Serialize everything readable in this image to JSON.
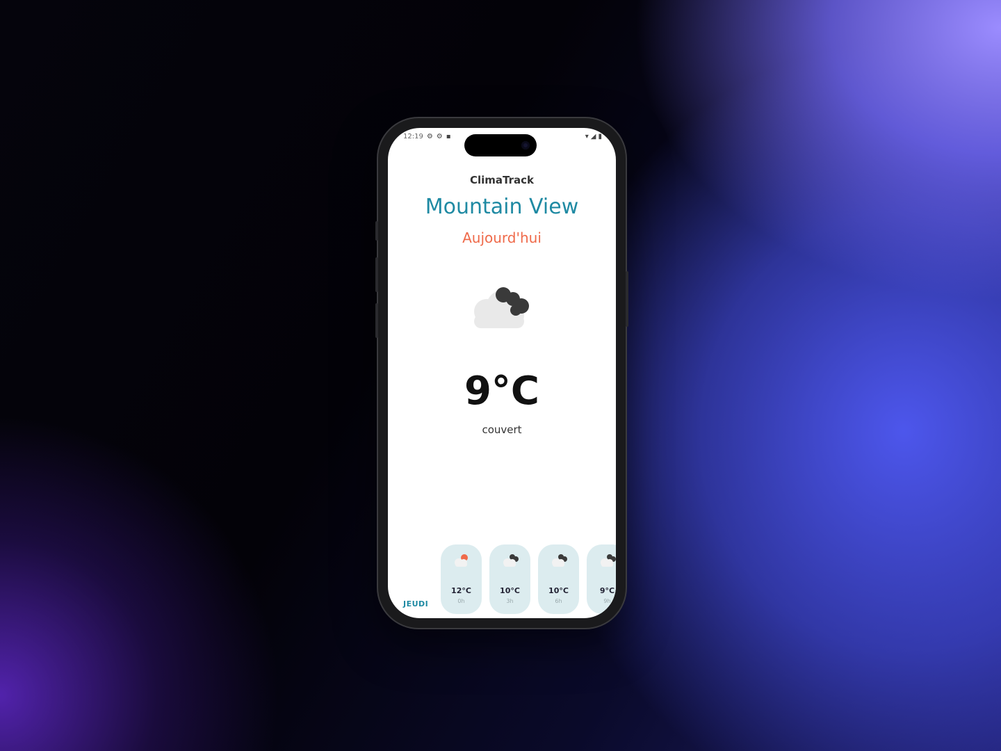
{
  "status": {
    "time": "12:19"
  },
  "app": {
    "name": "ClimaTrack"
  },
  "weather": {
    "city": "Mountain View",
    "day": "Aujourd'hui",
    "temperature": "9°C",
    "description": "couvert"
  },
  "forecast": {
    "day_label": "JEUDI",
    "items": [
      {
        "temp": "12°C",
        "time": "0h",
        "icon": "partly-cloudy-sun-icon"
      },
      {
        "temp": "10°C",
        "time": "3h",
        "icon": "cloudy-icon"
      },
      {
        "temp": "10°C",
        "time": "6h",
        "icon": "cloudy-icon"
      },
      {
        "temp": "9°C",
        "time": "9h",
        "icon": "cloudy-icon"
      }
    ]
  },
  "colors": {
    "city": "#1f8aa3",
    "day": "#ef6a4a",
    "card": "#dcecef"
  }
}
